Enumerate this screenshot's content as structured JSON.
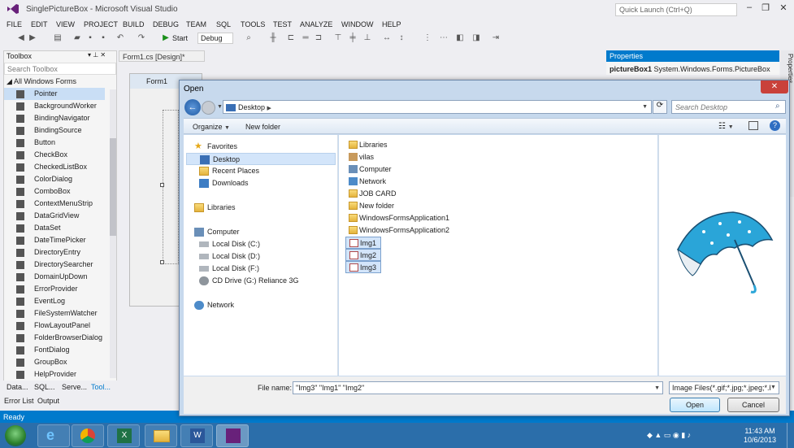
{
  "vs": {
    "window_title": "SinglePictureBox - Microsoft Visual Studio",
    "quick_launch": "Quick Launch (Ctrl+Q)",
    "menu": [
      "FILE",
      "EDIT",
      "VIEW",
      "PROJECT",
      "BUILD",
      "DEBUG",
      "TEAM",
      "SQL",
      "TOOLS",
      "TEST",
      "ANALYZE",
      "WINDOW",
      "HELP"
    ],
    "toolbar": {
      "start_label": "Start",
      "config": "Debug"
    },
    "toolbox": {
      "title": "Toolbox",
      "search_placeholder": "Search Toolbox",
      "group": "All Windows Forms",
      "items": [
        "Pointer",
        "BackgroundWorker",
        "BindingNavigator",
        "BindingSource",
        "Button",
        "CheckBox",
        "CheckedListBox",
        "ColorDialog",
        "ComboBox",
        "ContextMenuStrip",
        "DataGridView",
        "DataSet",
        "DateTimePicker",
        "DirectoryEntry",
        "DirectorySearcher",
        "DomainUpDown",
        "ErrorProvider",
        "EventLog",
        "FileSystemWatcher",
        "FlowLayoutPanel",
        "FolderBrowserDialog",
        "FontDialog",
        "GroupBox",
        "HelpProvider"
      ],
      "tabs": [
        "Data...",
        "SQL...",
        "Serve...",
        "Tool..."
      ]
    },
    "doc_tab": "Form1.cs [Design]*",
    "form_title": "Form1",
    "properties": {
      "title": "Properties",
      "object": "pictureBox1",
      "type": "System.Windows.Forms.PictureBox"
    },
    "bottom_tabs": [
      "Error List",
      "Output"
    ],
    "status": "Ready"
  },
  "dialog": {
    "title": "Open",
    "address": "Desktop",
    "search_placeholder": "Search Desktop",
    "organize_label": "Organize",
    "new_folder_label": "New folder",
    "nav": {
      "favorites_header": "Favorites",
      "favorites": [
        "Desktop",
        "Recent Places",
        "Downloads"
      ],
      "libraries": "Libraries",
      "computer_header": "Computer",
      "drives": [
        "Local Disk (C:)",
        "Local Disk (D:)",
        "Local Disk (F:)",
        "CD Drive (G:) Reliance 3G"
      ],
      "network": "Network"
    },
    "files": [
      {
        "name": "Libraries",
        "type": "library"
      },
      {
        "name": "vilas",
        "type": "user"
      },
      {
        "name": "Computer",
        "type": "computer"
      },
      {
        "name": "Network",
        "type": "network"
      },
      {
        "name": "JOB CARD",
        "type": "folder"
      },
      {
        "name": "New folder",
        "type": "folder"
      },
      {
        "name": "WindowsFormsApplication1",
        "type": "folder"
      },
      {
        "name": "WindowsFormsApplication2",
        "type": "folder"
      },
      {
        "name": "Img1",
        "type": "image",
        "selected": true
      },
      {
        "name": "Img2",
        "type": "image",
        "selected": true
      },
      {
        "name": "Img3",
        "type": "image",
        "selected": true
      }
    ],
    "file_name_label": "File name:",
    "file_name_value": "\"Img3\" \"Img1\" \"Img2\"",
    "file_type": "Image Files(*.gif;*.jpg;*.jpeg;*.b",
    "open_label": "Open",
    "cancel_label": "Cancel"
  },
  "taskbar": {
    "time": "11:43 AM",
    "date": "10/6/2013"
  },
  "colors": {
    "vs_accent": "#007acc",
    "dialog_frame": "#c7d9ed",
    "selection": "#d3e5fa",
    "close_red": "#c9413a"
  }
}
